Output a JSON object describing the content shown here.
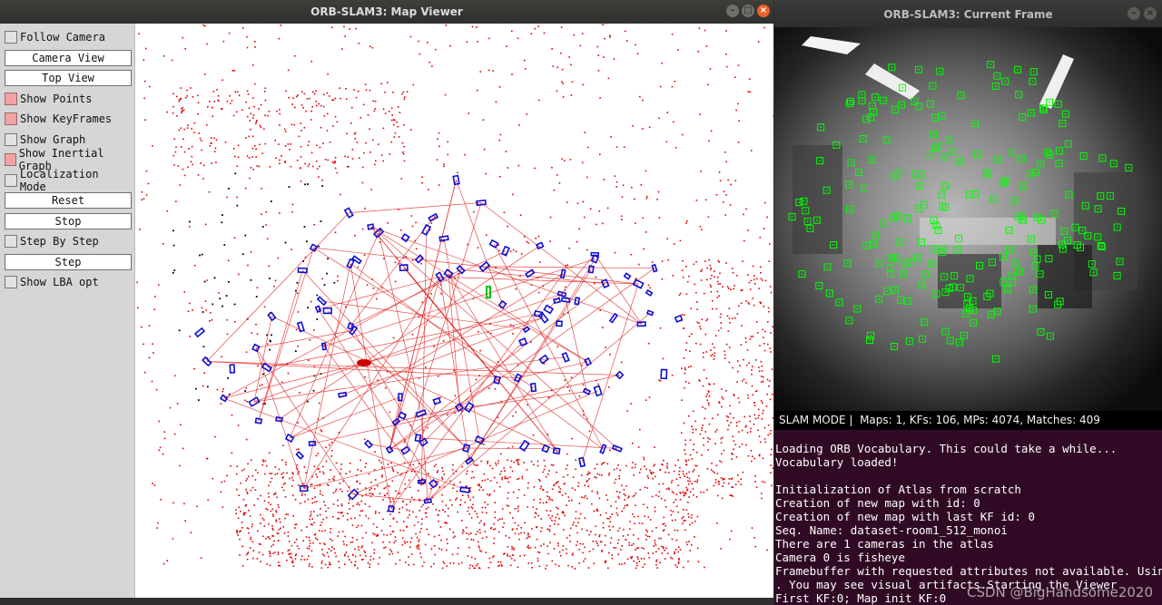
{
  "map_viewer": {
    "title": "ORB-SLAM3: Map Viewer",
    "window_buttons": [
      "–",
      "□",
      "×"
    ],
    "panel": [
      {
        "kind": "checkbox",
        "label": "Follow Camera",
        "checked": false
      },
      {
        "kind": "button",
        "label": "Camera View"
      },
      {
        "kind": "button",
        "label": "Top View"
      },
      {
        "kind": "checkbox",
        "label": "Show Points",
        "checked": true
      },
      {
        "kind": "checkbox",
        "label": "Show KeyFrames",
        "checked": true
      },
      {
        "kind": "checkbox",
        "label": "Show Graph",
        "checked": false
      },
      {
        "kind": "checkbox",
        "label": "Show Inertial Graph",
        "checked": true
      },
      {
        "kind": "checkbox",
        "label": "Localization Mode",
        "checked": false
      },
      {
        "kind": "button",
        "label": "Reset"
      },
      {
        "kind": "button",
        "label": "Stop"
      },
      {
        "kind": "checkbox",
        "label": "Step By Step",
        "checked": false
      },
      {
        "kind": "button",
        "label": "Step"
      },
      {
        "kind": "checkbox",
        "label": "Show LBA opt",
        "checked": false
      }
    ],
    "colors": {
      "map_points": "#e00000",
      "ref_points": "#000000",
      "keyframes": "#1010d0",
      "graph_edges": "#e02020",
      "current_camera": "#00c000",
      "trajectory": "#d00000"
    }
  },
  "current_frame": {
    "title": "ORB-SLAM3: Current Frame",
    "window_buttons": [
      "–",
      "×"
    ],
    "status": "SLAM MODE |  Maps: 1, KFs: 106, MPs: 4074, Matches: 409",
    "feature_color": "#00ff00"
  },
  "terminal": {
    "lines": [
      "Loading ORB Vocabulary. This could take a while...",
      "Vocabulary loaded!",
      "",
      "Initialization of Atlas from scratch",
      "Creation of new map with id: 0",
      "Creation of new map with last KF id: 0",
      "Seq. Name: dataset-room1_512_monoi",
      "There are 1 cameras in the atlas",
      "Camera 0 is fisheye",
      "Framebuffer with requested attributes not available. Usin",
      ". You may see visual artifacts.Starting the Viewer",
      "First KF:0; Map init KF:0"
    ],
    "watermark": "CSDN @BigHandsome2020"
  }
}
